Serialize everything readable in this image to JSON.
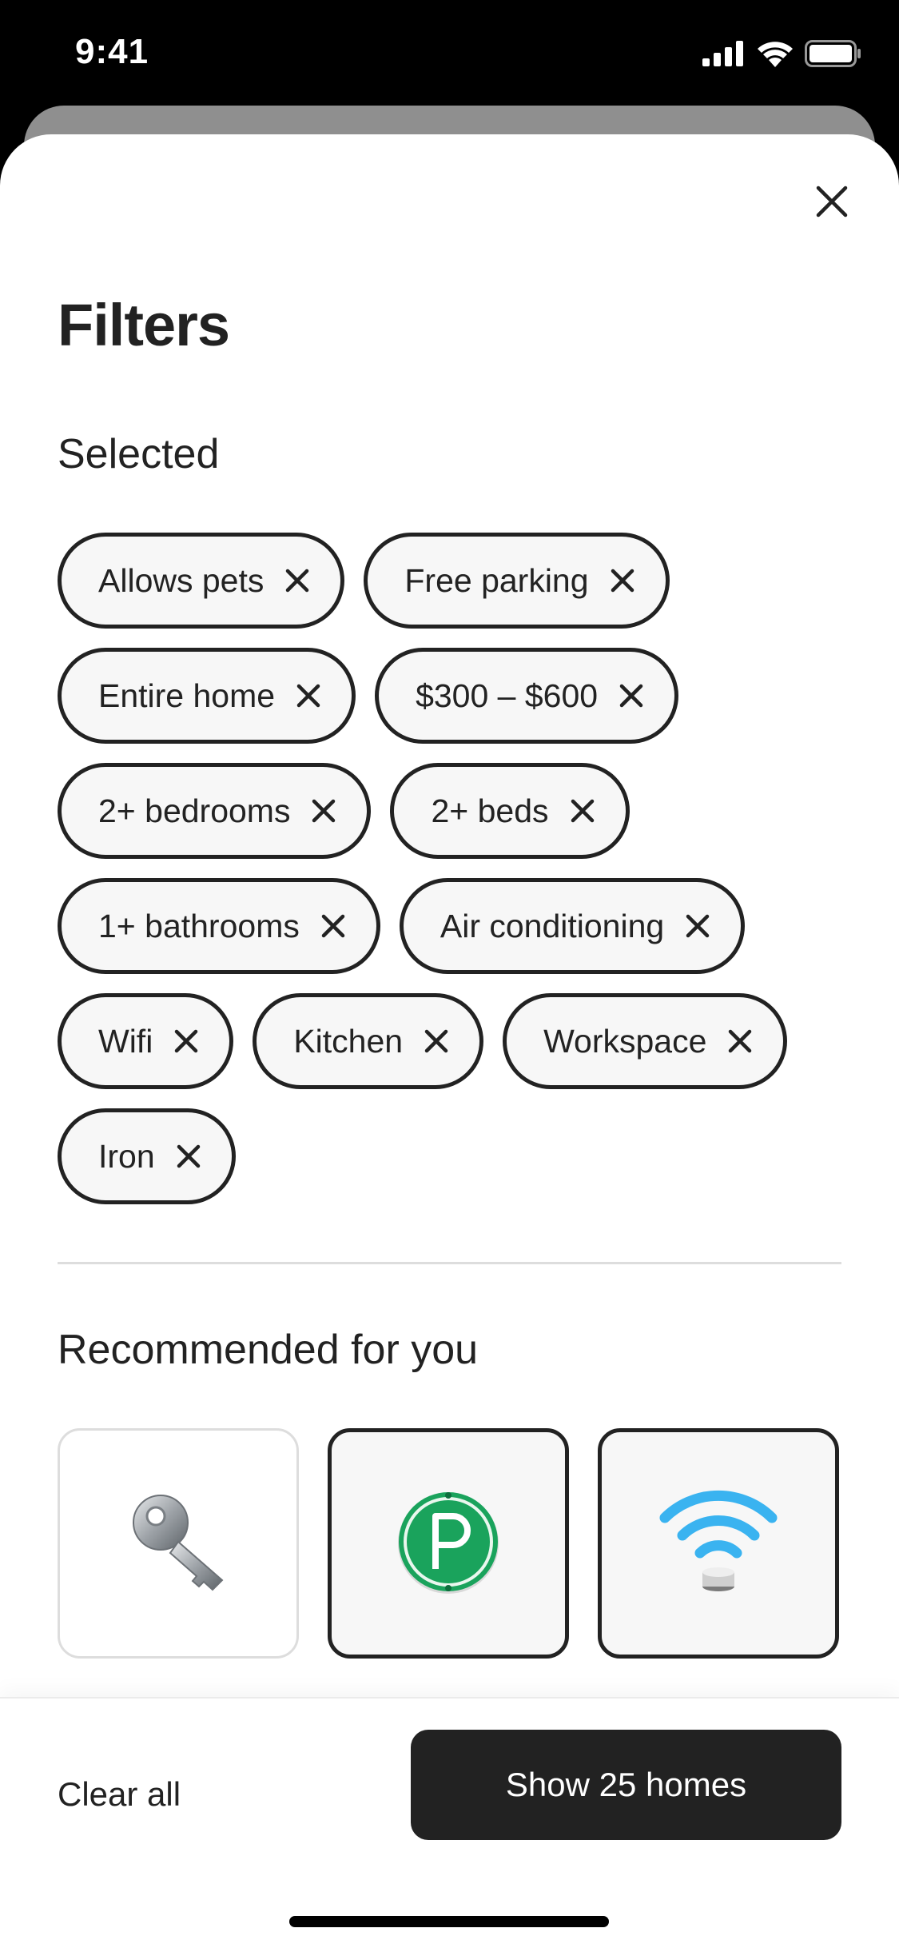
{
  "status_bar": {
    "time": "9:41",
    "icons": [
      "cellular-signal-icon",
      "wifi-icon",
      "battery-icon"
    ]
  },
  "sheet": {
    "title": "Filters",
    "close_icon": "close-icon"
  },
  "selected": {
    "heading": "Selected",
    "chips": [
      {
        "label": "Allows pets"
      },
      {
        "label": "Free parking"
      },
      {
        "label": "Entire home"
      },
      {
        "label": "$300 – $600"
      },
      {
        "label": "2+ bedrooms"
      },
      {
        "label": "2+ beds"
      },
      {
        "label": "1+ bathrooms"
      },
      {
        "label": "Air conditioning"
      },
      {
        "label": "Wifi"
      },
      {
        "label": "Kitchen"
      },
      {
        "label": "Workspace"
      },
      {
        "label": "Iron"
      }
    ]
  },
  "recommended": {
    "heading": "Recommended for you",
    "cards": [
      {
        "icon": "key-icon",
        "selected": false
      },
      {
        "icon": "parking-icon",
        "selected": true
      },
      {
        "icon": "wifi-icon",
        "selected": true
      }
    ]
  },
  "footer": {
    "clear_all": "Clear all",
    "show_button": "Show 25 homes"
  },
  "colors": {
    "text": "#222222",
    "chip_bg": "#f7f7f7",
    "divider": "#dddddd",
    "button_bg": "#222222",
    "parking_green": "#1aa35c",
    "wifi_blue": "#3ab3f0"
  }
}
